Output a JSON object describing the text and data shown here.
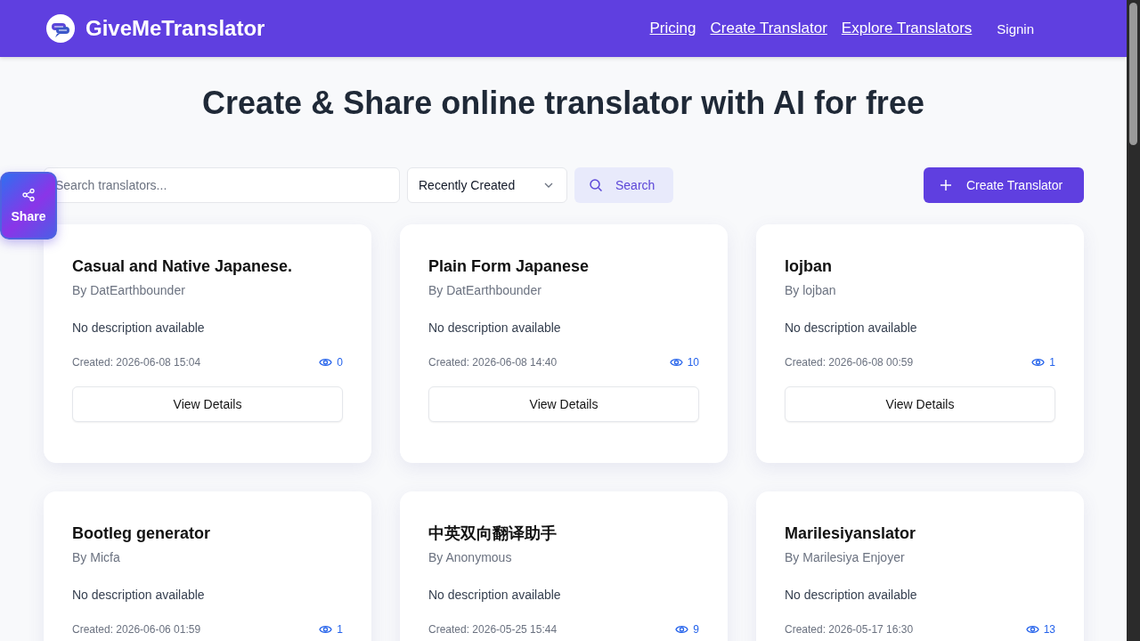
{
  "header": {
    "brand": "GiveMeTranslator",
    "links": [
      "Pricing",
      "Create Translator",
      "Explore Translators"
    ],
    "signin": "Signin"
  },
  "title": "Create & Share online translator with AI for free",
  "share": {
    "label": "Share"
  },
  "toolbar": {
    "search_placeholder": "Search translators...",
    "sort": "Recently Created",
    "search_button": "Search",
    "create_button": "Create Translator"
  },
  "cards": [
    {
      "title": "Casual and Native Japanese.",
      "author": "By DatEarthbounder",
      "description": "No description available",
      "created": "Created: 2026-06-08 15:04",
      "views": "0",
      "button": "View Details"
    },
    {
      "title": "Plain Form Japanese",
      "author": "By DatEarthbounder",
      "description": "No description available",
      "created": "Created: 2026-06-08 14:40",
      "views": "10",
      "button": "View Details"
    },
    {
      "title": "lojban",
      "author": "By lojban",
      "description": "No description available",
      "created": "Created: 2026-06-08 00:59",
      "views": "1",
      "button": "View Details"
    },
    {
      "title": "Bootleg generator",
      "author": "By Micfa",
      "description": "No description available",
      "created": "Created: 2026-06-06 01:59",
      "views": "1"
    },
    {
      "title": "中英双向翻译助手",
      "author": "By Anonymous",
      "description": "No description available",
      "created": "Created: 2026-05-25 15:44",
      "views": "9"
    },
    {
      "title": "Marilesiyanslator",
      "author": "By Marilesiya Enjoyer",
      "description": "No description available",
      "created": "Created: 2026-05-17 16:30",
      "views": "13"
    }
  ]
}
